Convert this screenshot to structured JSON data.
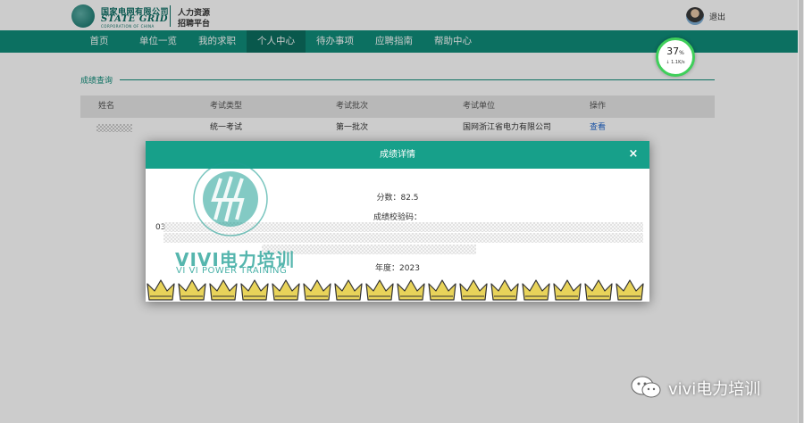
{
  "header": {
    "logo_cn": "国家电网有限公司",
    "logo_en": "STATE GRID",
    "logo_sub": "CORPORATION OF CHINA",
    "platform_line1": "人力资源",
    "platform_line2": "招聘平台",
    "logout": "退出"
  },
  "nav": {
    "items": [
      "首页",
      "单位一览",
      "我的求职",
      "个人中心",
      "待办事项",
      "应聘指南",
      "帮助中心"
    ],
    "active_index": 3
  },
  "speed_widget": {
    "percent": "37",
    "unit": "%",
    "rate": "↓ 1.1K/s"
  },
  "section": {
    "title": "成绩查询"
  },
  "table": {
    "headers": [
      "姓名",
      "考试类型",
      "考试批次",
      "考试单位",
      "操作"
    ],
    "rows": [
      {
        "type": "统一考试",
        "batch": "第一批次",
        "unit": "国网浙江省电力有限公司",
        "action": "查看"
      }
    ]
  },
  "modal": {
    "title": "成绩详情",
    "close": "×",
    "score": "分数：82.5",
    "verify_label": "成绩校验码：",
    "verify_prefix": "03",
    "year": "年度：2023"
  },
  "watermark": {
    "text": "VIVI电力培训",
    "sub": "VI VI POWER TRAINING"
  },
  "wechat": {
    "label": "vivi电力培训"
  },
  "colors": {
    "primary": "#0f8d7a",
    "modal_header": "#17a08a",
    "crown": "#e8d35a",
    "link": "#1f66cc"
  }
}
